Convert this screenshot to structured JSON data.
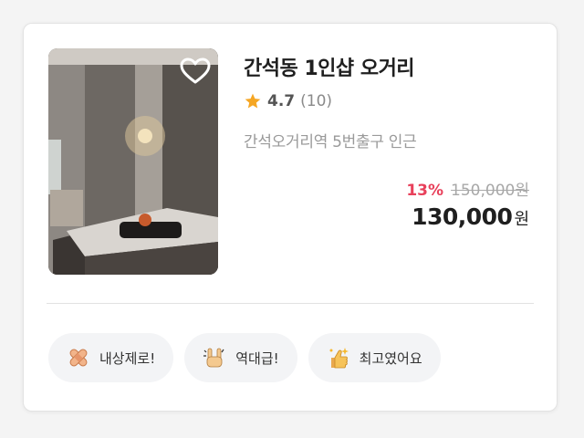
{
  "product": {
    "title": "간석동 1인샵 오거리",
    "rating": "4.7",
    "review_count": "(10)",
    "location": "간석오거리역 5번출구 인근",
    "discount": "13%",
    "original_price": "150,000원",
    "final_price": "130,000",
    "currency": "원"
  },
  "chips": [
    {
      "label": "내상제로!",
      "icon": "bandage-icon"
    },
    {
      "label": "역대급!",
      "icon": "rock-hand-icon"
    },
    {
      "label": "최고였어요",
      "icon": "thumbs-up-sparkle-icon"
    }
  ],
  "colors": {
    "star": "#f5a623",
    "discount": "#e8415b",
    "chip_bg": "#f3f4f6"
  }
}
